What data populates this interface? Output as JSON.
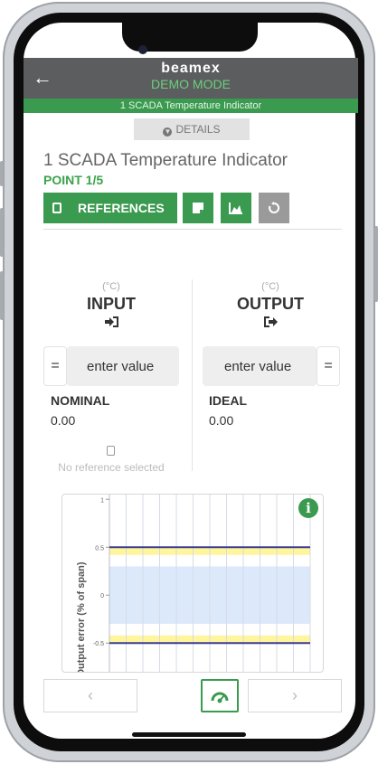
{
  "app": {
    "brand": "beamex",
    "mode": "DEMO MODE",
    "instrument_bar": "1 SCADA Temperature Indicator",
    "details_label": "DETAILS"
  },
  "header": {
    "title": "1 SCADA Temperature Indicator",
    "point": "POINT 1/5"
  },
  "toolbar": {
    "references_label": "REFERENCES",
    "icons": [
      "note-icon",
      "chart-area-icon",
      "reset-icon"
    ]
  },
  "input": {
    "unit": "(°C)",
    "label": "INPUT",
    "eq": "=",
    "placeholder": "enter value",
    "value_key": "NOMINAL",
    "value": "0.00",
    "reference_text": "No reference selected"
  },
  "output": {
    "unit": "(°C)",
    "label": "OUTPUT",
    "eq": "=",
    "placeholder": "enter value",
    "value_key": "IDEAL",
    "value": "0.00"
  },
  "colors": {
    "accent": "#3a9a4f",
    "appbar": "#5b5d5f",
    "mode_text": "#6cd07c",
    "limit_line": "#3b3b8f",
    "tolerance_band": "#fff59d",
    "acceptable_band": "#dce9fb"
  },
  "chart_data": {
    "type": "line",
    "ylabel": "Output error (% of span)",
    "xlabel": "",
    "ylim": [
      -0.8,
      1.05
    ],
    "y_ticks": [
      "1",
      "0.5",
      "0",
      "-0.5"
    ],
    "grid": true,
    "limit_lines": [
      0.5,
      -0.5
    ],
    "bands": [
      {
        "from": 0.42,
        "to": 0.5,
        "color": "#fff59d"
      },
      {
        "from": -0.3,
        "to": 0.3,
        "color": "#dce9fb"
      },
      {
        "from": -0.5,
        "to": -0.42,
        "color": "#fff59d"
      }
    ],
    "series": []
  }
}
